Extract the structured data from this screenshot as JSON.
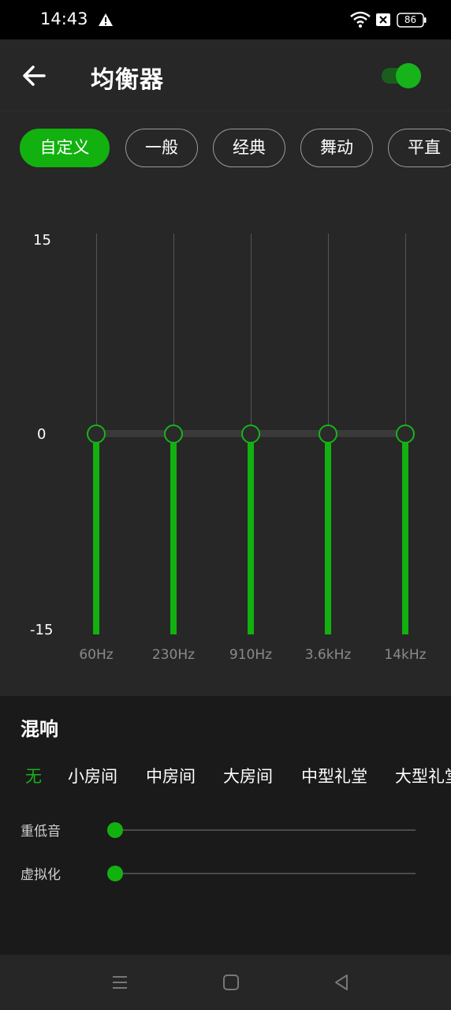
{
  "status_bar": {
    "time": "14:43",
    "battery": "86",
    "icons": [
      "warning-icon",
      "wifi-icon",
      "sim-x-icon",
      "battery-icon"
    ]
  },
  "header": {
    "title": "均衡器",
    "enabled": true
  },
  "presets": [
    {
      "label": "自定义",
      "active": true
    },
    {
      "label": "一般",
      "active": false
    },
    {
      "label": "经典",
      "active": false
    },
    {
      "label": "舞动",
      "active": false
    },
    {
      "label": "平直",
      "active": false
    }
  ],
  "eq": {
    "y_max": "15",
    "y_mid": "0",
    "y_min": "-15",
    "bands": [
      {
        "freq": "60Hz",
        "value": 0
      },
      {
        "freq": "230Hz",
        "value": 0
      },
      {
        "freq": "910Hz",
        "value": 0
      },
      {
        "freq": "3.6kHz",
        "value": 0
      },
      {
        "freq": "14kHz",
        "value": 0
      }
    ]
  },
  "reverb": {
    "title": "混响",
    "options": [
      {
        "label": "无",
        "active": true
      },
      {
        "label": "小房间",
        "active": false
      },
      {
        "label": "中房间",
        "active": false
      },
      {
        "label": "大房间",
        "active": false
      },
      {
        "label": "中型礼堂",
        "active": false
      },
      {
        "label": "大型礼堂",
        "active": false
      }
    ]
  },
  "sliders": [
    {
      "label": "重低音",
      "value": 0
    },
    {
      "label": "虚拟化",
      "value": 0
    }
  ],
  "colors": {
    "accent": "#12b10f",
    "background": "#272727",
    "panel": "#1a1a1a"
  }
}
